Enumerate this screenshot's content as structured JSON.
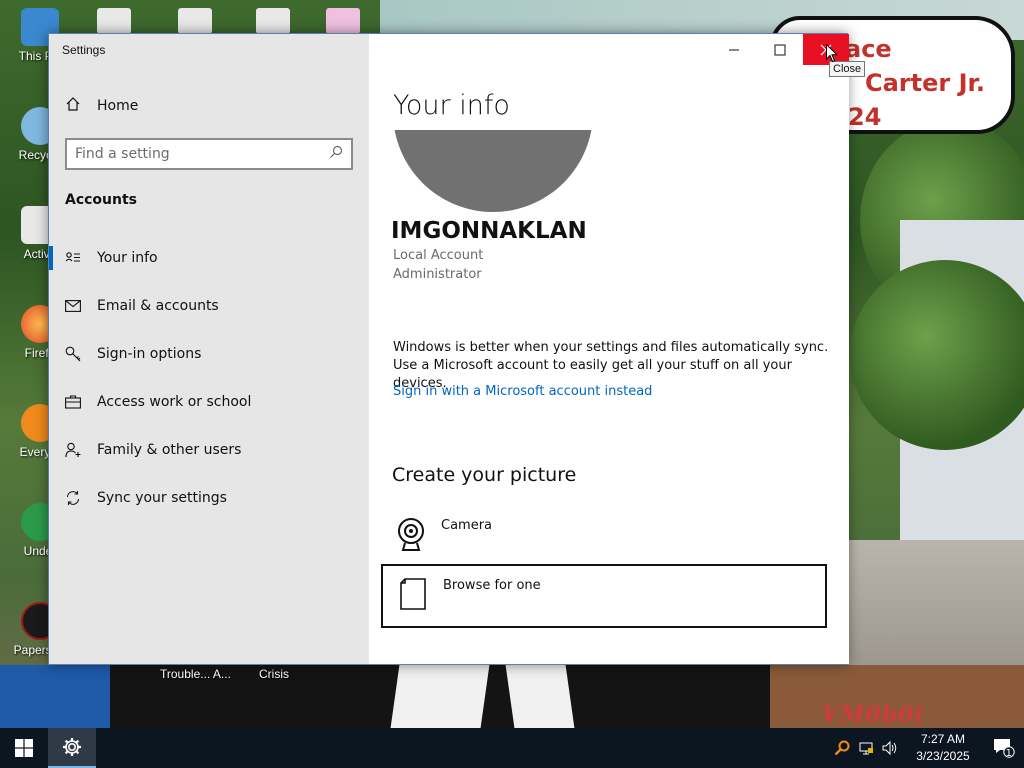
{
  "window": {
    "title": "Settings",
    "tooltip": "Close",
    "minimize_glyph": "—",
    "maximize_glyph": "☐",
    "close_glyph": "✕"
  },
  "sidebar": {
    "home_label": "Home",
    "search_placeholder": "Find a setting",
    "section_title": "Accounts",
    "items": [
      {
        "label": "Your info",
        "icon": "user-card-icon"
      },
      {
        "label": "Email & accounts",
        "icon": "mail-icon"
      },
      {
        "label": "Sign-in options",
        "icon": "key-icon"
      },
      {
        "label": "Access work or school",
        "icon": "briefcase-icon"
      },
      {
        "label": "Family & other users",
        "icon": "person-add-icon"
      },
      {
        "label": "Sync your settings",
        "icon": "sync-icon"
      }
    ]
  },
  "main": {
    "title": "Your info",
    "user_name": "IMGONNAKLAN",
    "account_type": "Local Account",
    "role": "Administrator",
    "sync_message": "Windows is better when your settings and files automatically sync. Use a Microsoft account to easily get all your stuff on all your devices.",
    "ms_link": "Sign in with a Microsoft account instead",
    "create_title": "Create your picture",
    "options": [
      {
        "label": "Camera",
        "icon": "camera-icon"
      },
      {
        "label": "Browse for one",
        "icon": "file-icon"
      }
    ]
  },
  "desktop": {
    "icons": [
      "This PC",
      "Recycle",
      "Activa",
      "Firefo",
      "Everyth",
      "Under",
      "Papers, P"
    ],
    "bottom_labels": [
      "Trouble... A...",
      "Crisis"
    ],
    "speech_lines": [
      "ace",
      "Carter Jr.",
      "24"
    ],
    "watermark": "VM0b0i"
  },
  "taskbar": {
    "time": "7:27 AM",
    "date": "3/23/2025",
    "notification_count": "1"
  },
  "colors": {
    "accent": "#0067c0",
    "close_red": "#e81123",
    "sidebar_bg": "#e6e6e6",
    "taskbar_bg": "#0c1620"
  }
}
